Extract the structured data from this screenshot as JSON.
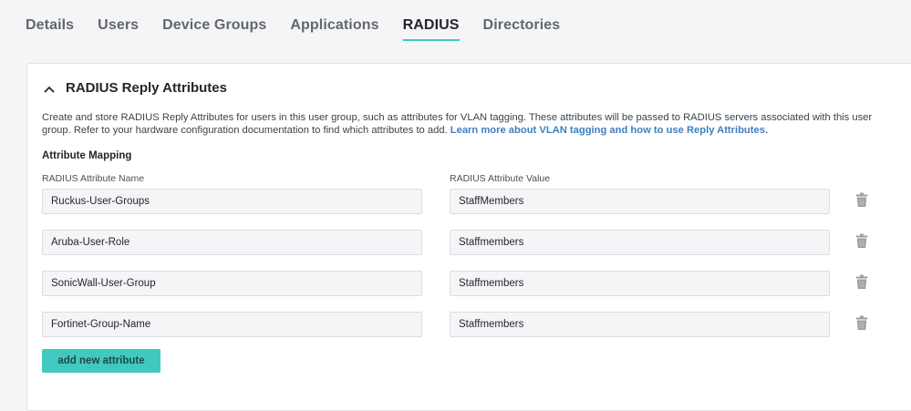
{
  "tabs": [
    {
      "label": "Details"
    },
    {
      "label": "Users"
    },
    {
      "label": "Device Groups"
    },
    {
      "label": "Applications"
    },
    {
      "label": "RADIUS"
    },
    {
      "label": "Directories"
    }
  ],
  "active_tab": "RADIUS",
  "panel": {
    "title": "RADIUS Reply Attributes",
    "description": "Create and store RADIUS Reply Attributes for users in this user group, such as attributes for VLAN tagging. These attributes will be passed to RADIUS servers associated with this user group. Refer to your hardware configuration documentation to find which attributes to add.",
    "learn_more_link": "Learn more about VLAN tagging and how to use Reply Attributes.",
    "mapping_title": "Attribute Mapping",
    "name_column_label": "RADIUS Attribute Name",
    "value_column_label": "RADIUS Attribute Value",
    "attributes": [
      {
        "name": "Ruckus-User-Groups",
        "value": "StaffMembers"
      },
      {
        "name": "Aruba-User-Role",
        "value": "Staffmembers"
      },
      {
        "name": "SonicWall-User-Group",
        "value": "Staffmembers"
      },
      {
        "name": "Fortinet-Group-Name",
        "value": "Staffmembers"
      }
    ],
    "add_button_label": "add new attribute"
  },
  "colors": {
    "accent": "#41c8c0",
    "link": "#3f7fbf",
    "background": "#f5f5f8"
  },
  "icons": {
    "collapse": "chevron-up-icon",
    "delete": "trash-icon"
  }
}
